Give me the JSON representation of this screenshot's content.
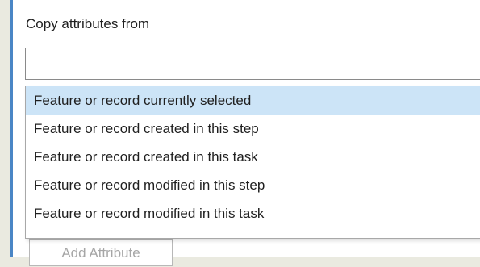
{
  "copy_attributes": {
    "label": "Copy attributes from",
    "current_value": "",
    "options": [
      "Feature or record currently selected",
      "Feature or record created in this step",
      "Feature or record created in this task",
      "Feature or record modified in this step",
      "Feature or record modified in this task"
    ],
    "highlighted_option": "Feature or record currently selected"
  },
  "add_attribute_button": {
    "label": "Add Attribute",
    "state": "disabled"
  },
  "colors": {
    "panel_accent": "#4a86c5",
    "highlight": "#cce4f7",
    "background": "#eaeae0"
  }
}
